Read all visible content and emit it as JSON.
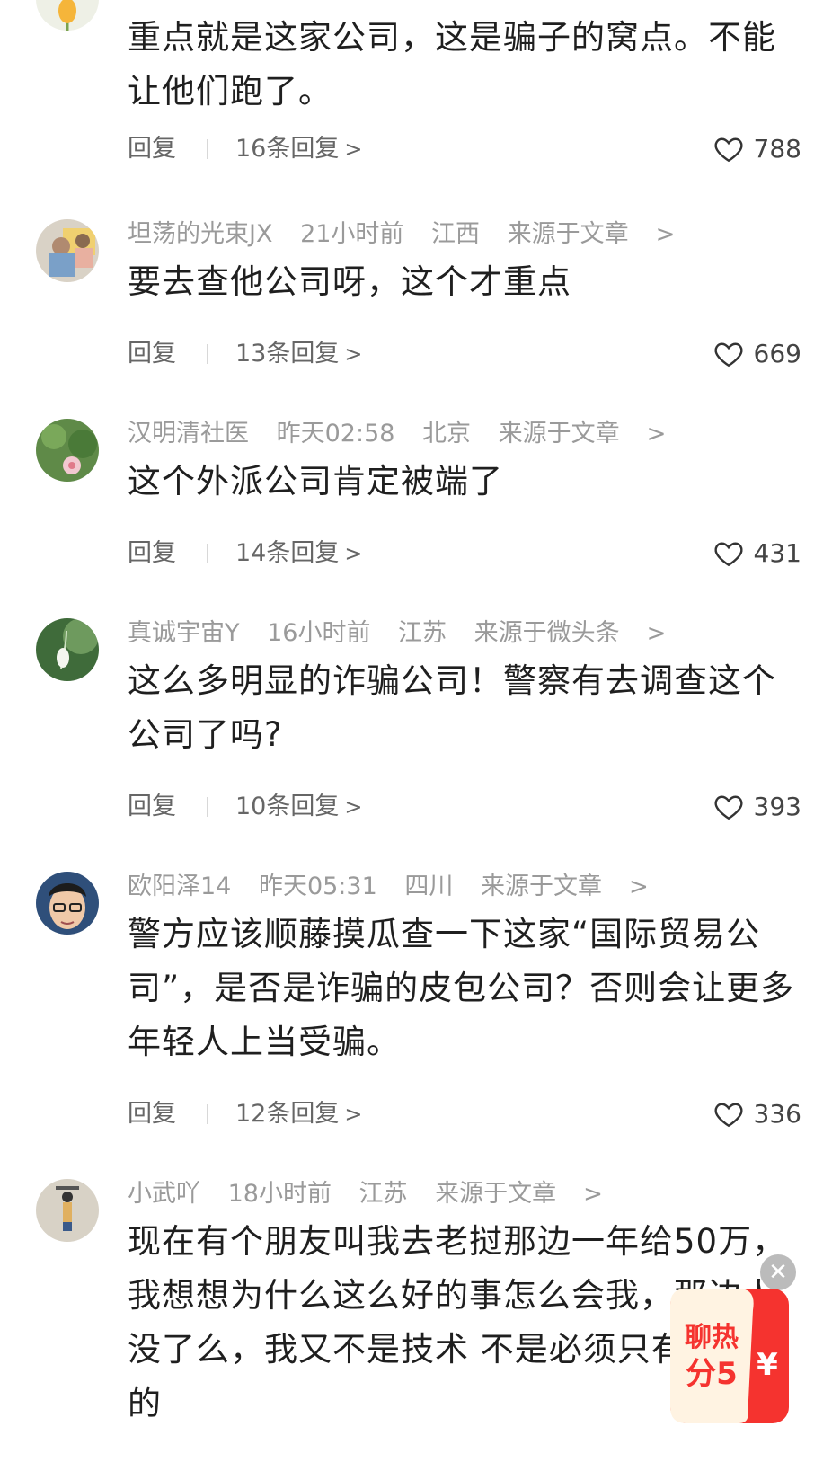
{
  "ui": {
    "reply_label": "回复",
    "accent": "#f04142"
  },
  "comments": [
    {
      "user": "",
      "time": "",
      "region": "",
      "source": "",
      "text": "重点就是这家公司，这是骗子的窝点。不能让他们跑了。",
      "replies": "16条回复",
      "likes": "788"
    },
    {
      "user": "坦荡的光束JX",
      "time": "21小时前",
      "region": "江西",
      "source": "来源于文章",
      "text": "要去查他公司呀，这个才重点",
      "replies": "13条回复",
      "likes": "669"
    },
    {
      "user": "汉明清社医",
      "time": "昨天02:58",
      "region": "北京",
      "source": "来源于文章",
      "text": "这个外派公司肯定被端了",
      "replies": "14条回复",
      "likes": "431"
    },
    {
      "user": "真诚宇宙Y",
      "time": "16小时前",
      "region": "江苏",
      "source": "来源于微头条",
      "text": "这么多明显的诈骗公司！警察有去调查这个公司了吗?",
      "replies": "10条回复",
      "likes": "393"
    },
    {
      "user": "欧阳泽14",
      "time": "昨天05:31",
      "region": "四川",
      "source": "来源于文章",
      "text": "警方应该顺藤摸瓜查一下这家“国际贸易公司”，是否是诈骗的皮包公司？否则会让更多年轻人上当受骗。",
      "replies": "12条回复",
      "likes": "336"
    },
    {
      "user": "小武吖",
      "time": "18小时前",
      "region": "江苏",
      "source": "来源于文章",
      "text": "现在有个朋友叫我去老挝那边一年给50万，我想想为什么这么好的事怎么会我，那边人没了么，我又不是技术 不是必须只有我能做的",
      "replies": "",
      "likes": ""
    }
  ],
  "float_widget": {
    "line1": "聊热",
    "line2": "分5",
    "currency": "¥",
    "close": "✕"
  }
}
